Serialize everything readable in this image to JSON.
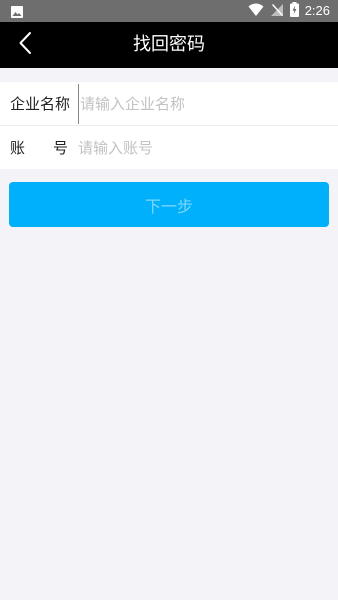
{
  "status_bar": {
    "time": "2:26",
    "icons": [
      "image-icon",
      "wifi-icon",
      "signal-icon",
      "battery-charging-icon"
    ]
  },
  "nav": {
    "title": "找回密码",
    "back_icon": "chevron-left-icon"
  },
  "form": {
    "company": {
      "label": "企业名称",
      "placeholder": "请输入企业名称",
      "value": ""
    },
    "account": {
      "label_chars": [
        "账",
        "号"
      ],
      "placeholder": "请输入账号",
      "value": ""
    }
  },
  "next_button": {
    "label": "下一步"
  },
  "colors": {
    "status_bar": "#6e6e6e",
    "nav_bar": "#000000",
    "background": "#f4f4f8",
    "accent": "#00b0fb",
    "button_text": "#7fd6fb",
    "placeholder": "#c2c2c2"
  }
}
